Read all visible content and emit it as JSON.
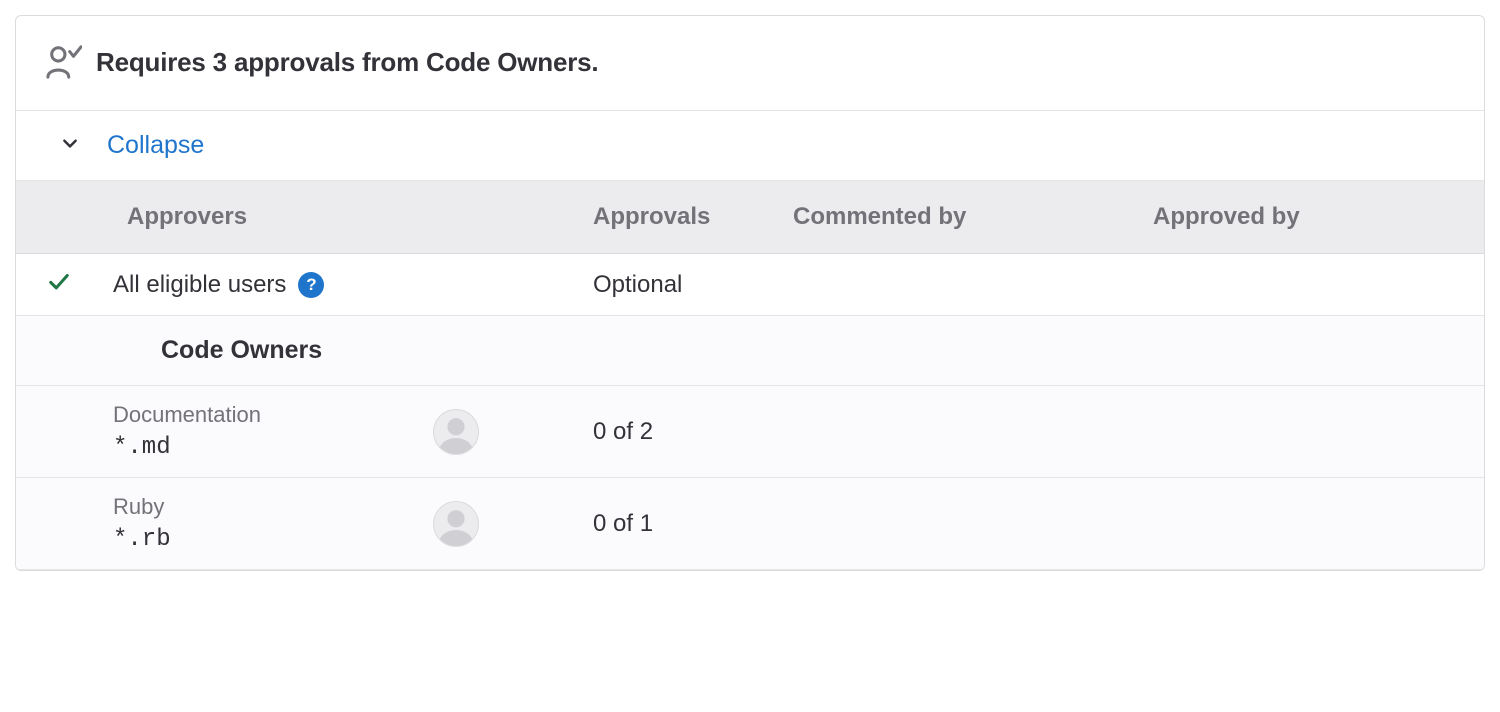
{
  "header": {
    "title": "Requires 3 approvals from Code Owners."
  },
  "collapse": {
    "label": "Collapse"
  },
  "columns": {
    "approvers": "Approvers",
    "approvals": "Approvals",
    "commented_by": "Commented by",
    "approved_by": "Approved by"
  },
  "eligible_row": {
    "label": "All eligible users",
    "approvals": "Optional"
  },
  "section": {
    "label": "Code Owners"
  },
  "owners": [
    {
      "name": "Documentation",
      "pattern": "*.md",
      "approvals": "0 of 2"
    },
    {
      "name": "Ruby",
      "pattern": "*.rb",
      "approvals": "0 of 1"
    }
  ]
}
